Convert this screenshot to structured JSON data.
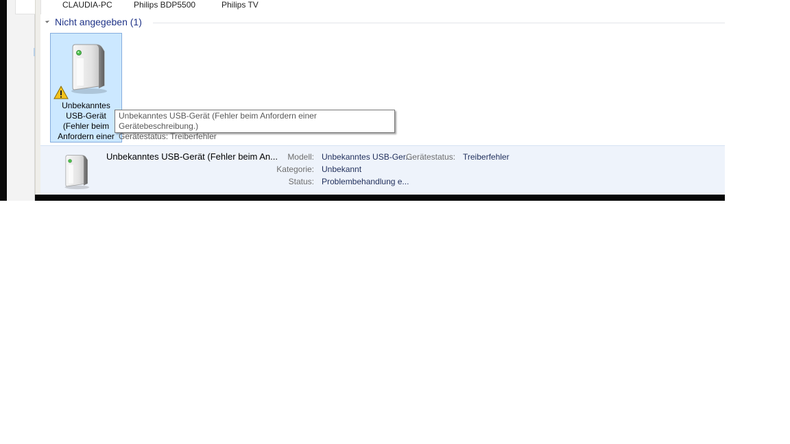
{
  "top_devices": [
    "CLAUDIA-PC",
    "Philips BDP5500",
    "Philips TV"
  ],
  "group": {
    "title": "Nicht angegeben (1)"
  },
  "tile": {
    "label": "Unbekanntes USB-Gerät (Fehler beim Anfordern einer Gerätebes..."
  },
  "tooltip": {
    "line1": "Unbekanntes USB-Gerät (Fehler beim Anfordern einer Gerätebeschreibung.)",
    "line2": "Gerätestatus: Treiberfehler"
  },
  "details": {
    "name": "Unbekanntes USB-Gerät (Fehler beim An...",
    "model_label": "Modell:",
    "model_value": "Unbekanntes USB-Ger...",
    "status_label": "Gerätestatus:",
    "status_value": "Treiberfehler",
    "category_label": "Kategorie:",
    "category_value": "Unbekannt",
    "state_label": "Status:",
    "state_value": "Problembehandlung e..."
  },
  "colors": {
    "accent": "#1e3287",
    "selection_bg": "#cce8ff",
    "selection_border": "#84acdd",
    "details_bg": "#eef3fb"
  },
  "icons": {
    "device": "device-tower-icon",
    "warning": "warning-icon"
  }
}
